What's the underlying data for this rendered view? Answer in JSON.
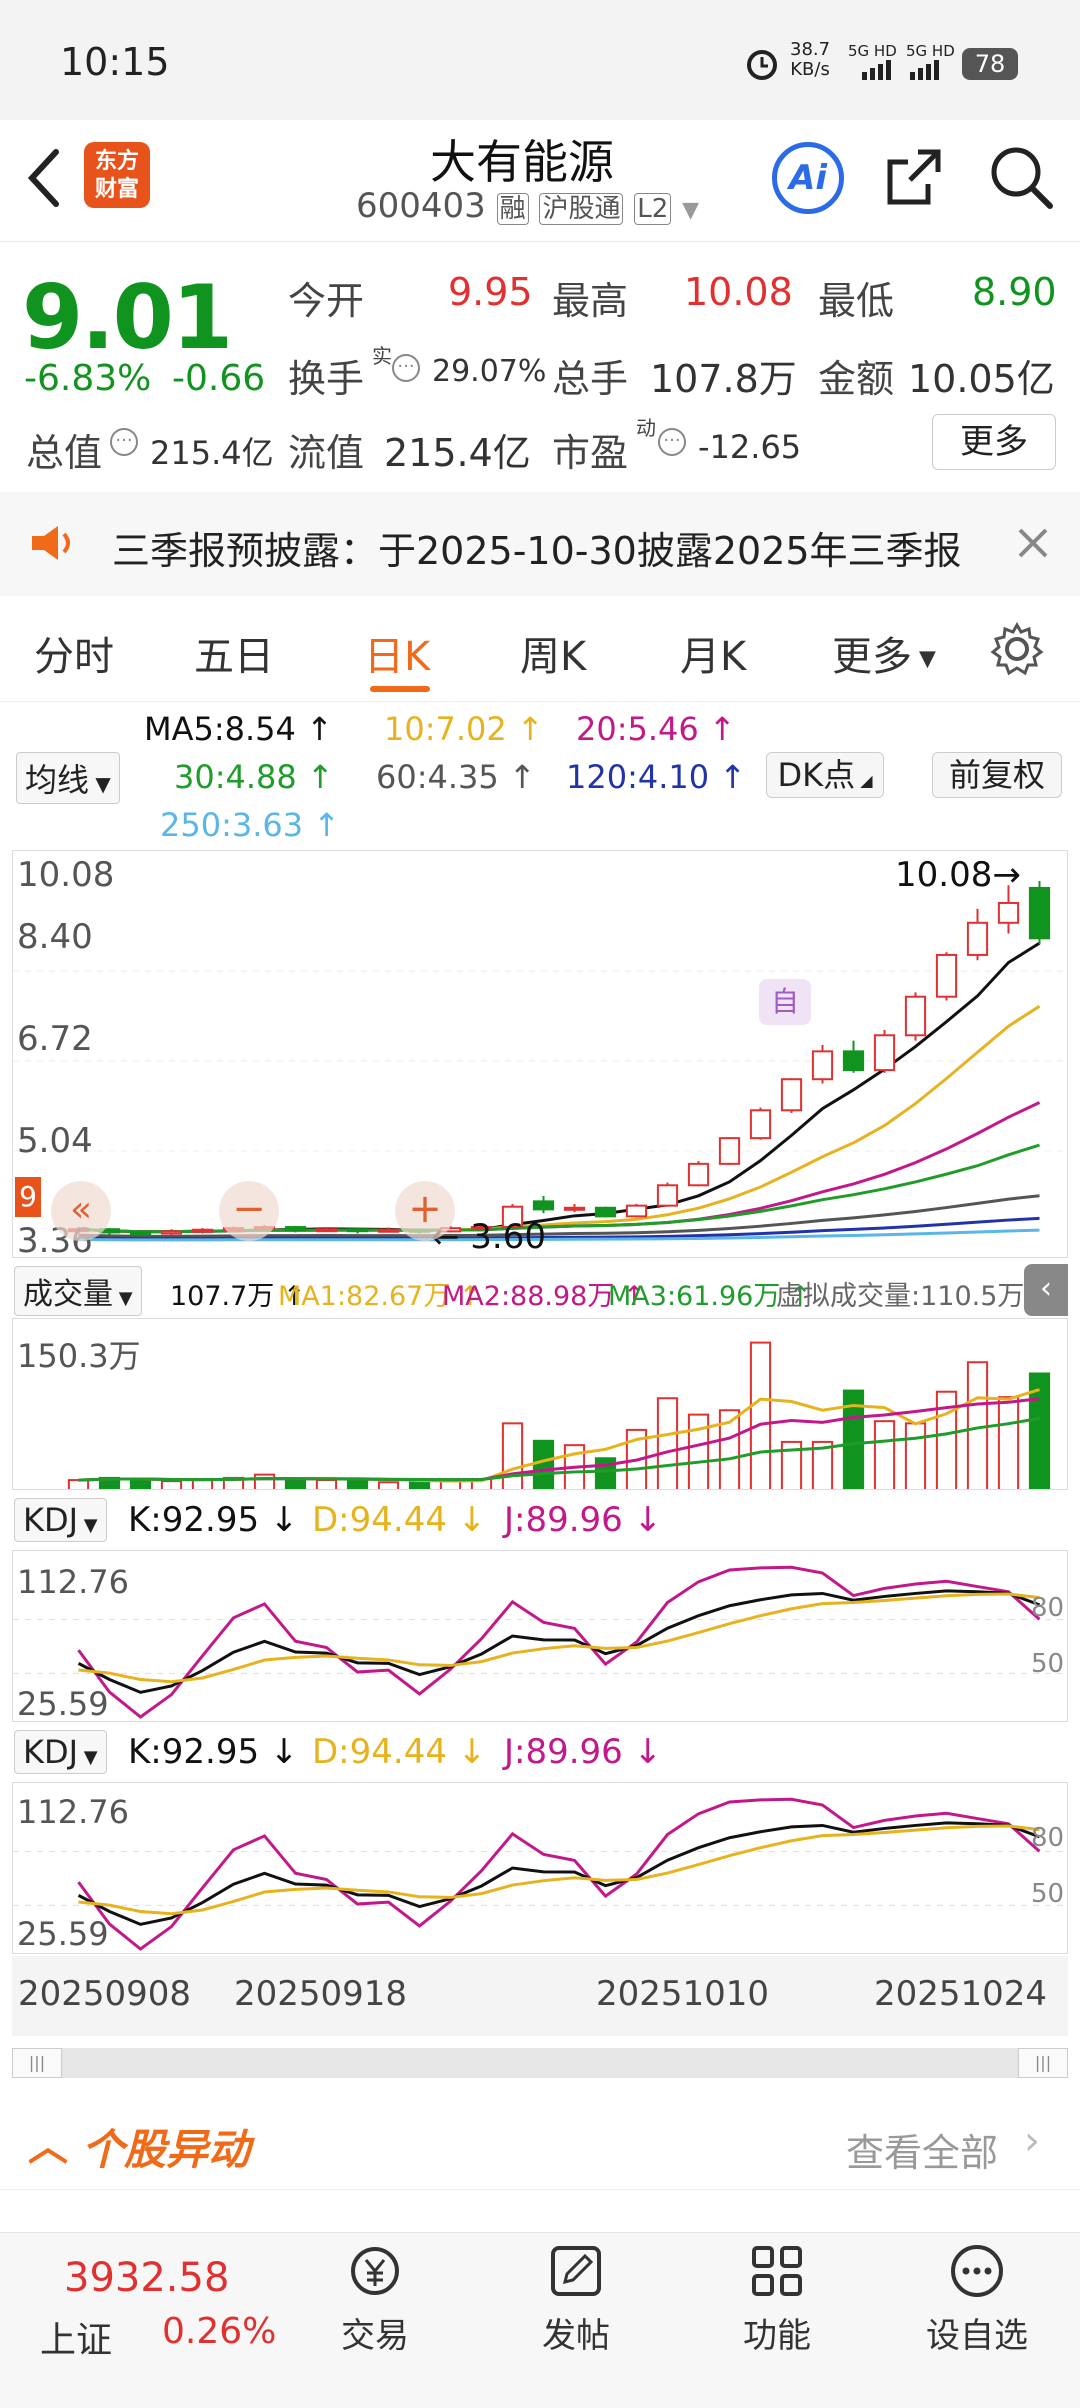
{
  "status": {
    "time": "10:15",
    "net_speed": "38.7",
    "net_unit": "KB/s",
    "sig1": "5G HD",
    "sig2": "5G HD",
    "battery": "78"
  },
  "header": {
    "logo_line1": "东方",
    "logo_line2": "财富",
    "stock_name": "大有能源",
    "stock_code": "600403",
    "tag_rong": "融",
    "tag_hgt": "沪股通",
    "tag_l2": "L2",
    "ai_label": "Ai"
  },
  "quote": {
    "price": "9.01",
    "change_pct": "-6.83%",
    "change": "-0.66",
    "jinkai_label": "今开",
    "jinkai": "9.95",
    "zuigao_label": "最高",
    "zuigao": "10.08",
    "zuidi_label": "最低",
    "zuidi": "8.90",
    "huanshou_label": "换手",
    "huanshou_sup": "实",
    "huanshou": "29.07%",
    "zongshou_label": "总手",
    "zongshou": "107.8万",
    "jine_label": "金额",
    "jine": "10.05亿",
    "zongzhi_label": "总值",
    "zongzhi": "215.4亿",
    "liuzhi_label": "流值",
    "liuzhi": "215.4亿",
    "shiying_label": "市盈",
    "shiying_sup": "动",
    "shiying": "-12.65",
    "more_button": "更多"
  },
  "notice": {
    "text": "三季报预披露：于2025-10-30披露2025年三季报"
  },
  "tabs": [
    "分时",
    "五日",
    "日K",
    "周K",
    "月K",
    "更多"
  ],
  "active_tab": "日K",
  "ma": {
    "selector": "均线",
    "ma5": "MA5:8.54 ↑",
    "ma10": "10:7.02 ↑",
    "ma20": "20:5.46 ↑",
    "ma30": "30:4.88 ↑",
    "ma60": "60:4.35 ↑",
    "ma120": "120:4.10 ↑",
    "ma250": "250:3.63 ↑",
    "dk_button": "DK点",
    "fq_button": "前复权"
  },
  "colors": {
    "up": "#e03030",
    "down": "#11941f",
    "ma5": "#111111",
    "ma10": "#e6b31e",
    "ma20": "#c2188a",
    "ma30": "#1f9c2a",
    "ma60": "#555555",
    "ma120": "#2233aa",
    "ma250": "#5bb6e8",
    "accent": "#f06a18"
  },
  "kline": {
    "y_labels": [
      "10.08",
      "8.40",
      "6.72",
      "5.04",
      "3.36"
    ],
    "max_label": "10.08",
    "min_label": "3.60",
    "signal_9": "9",
    "zi": "自"
  },
  "volume": {
    "selector": "成交量",
    "vol": "107.7万 ↑",
    "ma1": "MA1:82.67万 ↑",
    "ma2": "MA2:88.98万 ↑",
    "ma3": "MA3:61.96万 ↑",
    "virtual": "虚拟成交量:110.5万",
    "max": "150.3万"
  },
  "kdj1": {
    "selector": "KDJ",
    "k": "K:92.95 ↓",
    "d": "D:94.44 ↓",
    "j": "J:89.96 ↓",
    "top": "112.76",
    "bottom": "25.59",
    "r80": "80",
    "r50": "50"
  },
  "kdj2": {
    "selector": "KDJ",
    "k": "K:92.95 ↓",
    "d": "D:94.44 ↓",
    "j": "J:89.96 ↓",
    "top": "112.76",
    "bottom": "25.59",
    "r80": "80",
    "r50": "50"
  },
  "dates": [
    "20250908",
    "20250918",
    "20251010",
    "20251024"
  ],
  "movement": {
    "title": "个股异动",
    "view_all": "查看全部"
  },
  "bottom": {
    "index_value": "3932.58",
    "index_name": "上证",
    "index_change": "0.26%",
    "trade": "交易",
    "post": "发帖",
    "func": "功能",
    "watch": "设自选"
  },
  "chart_data": {
    "type": "candlestick",
    "candles": [
      {
        "o": 3.55,
        "c": 3.58,
        "h": 3.62,
        "l": 3.5
      },
      {
        "o": 3.58,
        "c": 3.52,
        "h": 3.6,
        "l": 3.48
      },
      {
        "o": 3.52,
        "c": 3.5,
        "h": 3.56,
        "l": 3.46
      },
      {
        "o": 3.5,
        "c": 3.54,
        "h": 3.58,
        "l": 3.47
      },
      {
        "o": 3.54,
        "c": 3.57,
        "h": 3.6,
        "l": 3.5
      },
      {
        "o": 3.57,
        "c": 3.6,
        "h": 3.63,
        "l": 3.53
      },
      {
        "o": 3.6,
        "c": 3.62,
        "h": 3.66,
        "l": 3.56
      },
      {
        "o": 3.62,
        "c": 3.56,
        "h": 3.64,
        "l": 3.52
      },
      {
        "o": 3.56,
        "c": 3.58,
        "h": 3.62,
        "l": 3.53
      },
      {
        "o": 3.58,
        "c": 3.55,
        "h": 3.6,
        "l": 3.5
      },
      {
        "o": 3.55,
        "c": 3.57,
        "h": 3.61,
        "l": 3.52
      },
      {
        "o": 3.57,
        "c": 3.54,
        "h": 3.59,
        "l": 3.5
      },
      {
        "o": 3.54,
        "c": 3.6,
        "h": 3.64,
        "l": 3.52
      },
      {
        "o": 3.6,
        "c": 3.62,
        "h": 3.66,
        "l": 3.58
      },
      {
        "o": 3.62,
        "c": 4.0,
        "h": 4.05,
        "l": 3.6
      },
      {
        "o": 4.1,
        "c": 3.95,
        "h": 4.2,
        "l": 3.88
      },
      {
        "o": 3.95,
        "c": 3.98,
        "h": 4.05,
        "l": 3.9
      },
      {
        "o": 3.98,
        "c": 3.82,
        "h": 4.0,
        "l": 3.8
      },
      {
        "o": 3.82,
        "c": 4.02,
        "h": 4.05,
        "l": 3.8
      },
      {
        "o": 4.02,
        "c": 4.4,
        "h": 4.45,
        "l": 4.0
      },
      {
        "o": 4.4,
        "c": 4.8,
        "h": 4.85,
        "l": 4.38
      },
      {
        "o": 4.8,
        "c": 5.28,
        "h": 5.3,
        "l": 4.78
      },
      {
        "o": 5.28,
        "c": 5.8,
        "h": 5.85,
        "l": 5.25
      },
      {
        "o": 5.8,
        "c": 6.38,
        "h": 6.4,
        "l": 5.75
      },
      {
        "o": 6.38,
        "c": 6.9,
        "h": 7.02,
        "l": 6.3
      },
      {
        "o": 6.9,
        "c": 6.55,
        "h": 7.1,
        "l": 6.5
      },
      {
        "o": 6.55,
        "c": 7.2,
        "h": 7.3,
        "l": 6.5
      },
      {
        "o": 7.2,
        "c": 7.92,
        "h": 8.0,
        "l": 7.1
      },
      {
        "o": 7.92,
        "c": 8.7,
        "h": 8.75,
        "l": 7.85
      },
      {
        "o": 8.7,
        "c": 9.3,
        "h": 9.56,
        "l": 8.6
      },
      {
        "o": 9.3,
        "c": 9.67,
        "h": 10.0,
        "l": 9.1
      },
      {
        "o": 9.95,
        "c": 9.01,
        "h": 10.08,
        "l": 8.9
      }
    ],
    "volumes": [
      10,
      12,
      11,
      9,
      10,
      12,
      15,
      11,
      10,
      9,
      8,
      10,
      9,
      11,
      62,
      46,
      42,
      30,
      56,
      85,
      70,
      74,
      136,
      45,
      45,
      92,
      64,
      62,
      91,
      118,
      86,
      107.7
    ],
    "y_range": [
      3.36,
      10.08
    ],
    "vol_max": 150.3
  }
}
